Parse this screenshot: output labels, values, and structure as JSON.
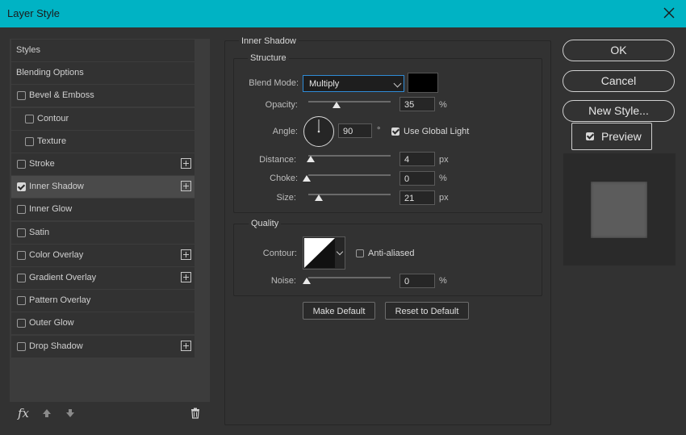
{
  "window": {
    "title": "Layer Style"
  },
  "styles_list": [
    {
      "label": "Styles",
      "checkbox": false,
      "checked": false,
      "indent": 0,
      "plus": false
    },
    {
      "label": "Blending Options",
      "checkbox": false,
      "checked": false,
      "indent": 0,
      "plus": false
    },
    {
      "label": "Bevel & Emboss",
      "checkbox": true,
      "checked": false,
      "indent": 0,
      "plus": false
    },
    {
      "label": "Contour",
      "checkbox": true,
      "checked": false,
      "indent": 1,
      "plus": false
    },
    {
      "label": "Texture",
      "checkbox": true,
      "checked": false,
      "indent": 1,
      "plus": false
    },
    {
      "label": "Stroke",
      "checkbox": true,
      "checked": false,
      "indent": 0,
      "plus": true
    },
    {
      "label": "Inner Shadow",
      "checkbox": true,
      "checked": true,
      "indent": 0,
      "plus": true,
      "active": true
    },
    {
      "label": "Inner Glow",
      "checkbox": true,
      "checked": false,
      "indent": 0,
      "plus": false
    },
    {
      "label": "Satin",
      "checkbox": true,
      "checked": false,
      "indent": 0,
      "plus": false
    },
    {
      "label": "Color Overlay",
      "checkbox": true,
      "checked": false,
      "indent": 0,
      "plus": true
    },
    {
      "label": "Gradient Overlay",
      "checkbox": true,
      "checked": false,
      "indent": 0,
      "plus": true
    },
    {
      "label": "Pattern Overlay",
      "checkbox": true,
      "checked": false,
      "indent": 0,
      "plus": false
    },
    {
      "label": "Outer Glow",
      "checkbox": true,
      "checked": false,
      "indent": 0,
      "plus": false
    },
    {
      "label": "Drop Shadow",
      "checkbox": true,
      "checked": false,
      "indent": 0,
      "plus": true
    }
  ],
  "bottom_icons": {
    "fx": "fx",
    "icons": [
      "fx-icon",
      "move-up-icon",
      "move-down-icon",
      "trash-icon"
    ]
  },
  "inner_shadow": {
    "title": "Inner Shadow",
    "structure": {
      "title": "Structure",
      "blend_mode_label": "Blend Mode:",
      "blend_mode_value": "Multiply",
      "shadow_color": "#000000",
      "opacity_label": "Opacity:",
      "opacity_value": "35",
      "opacity_unit": "%",
      "angle_label": "Angle:",
      "angle_value": "90",
      "angle_unit": "°",
      "use_global_light_label": "Use Global Light",
      "use_global_light": true,
      "distance_label": "Distance:",
      "distance_value": "4",
      "distance_unit": "px",
      "choke_label": "Choke:",
      "choke_value": "0",
      "choke_unit": "%",
      "size_label": "Size:",
      "size_value": "21",
      "size_unit": "px"
    },
    "quality": {
      "title": "Quality",
      "contour_label": "Contour:",
      "anti_aliased_label": "Anti-aliased",
      "anti_aliased": false,
      "noise_label": "Noise:",
      "noise_value": "0",
      "noise_unit": "%"
    },
    "make_default_label": "Make Default",
    "reset_default_label": "Reset to Default"
  },
  "actions": {
    "ok_label": "OK",
    "cancel_label": "Cancel",
    "new_style_label": "New Style...",
    "preview_label": "Preview",
    "preview_checked": true
  }
}
